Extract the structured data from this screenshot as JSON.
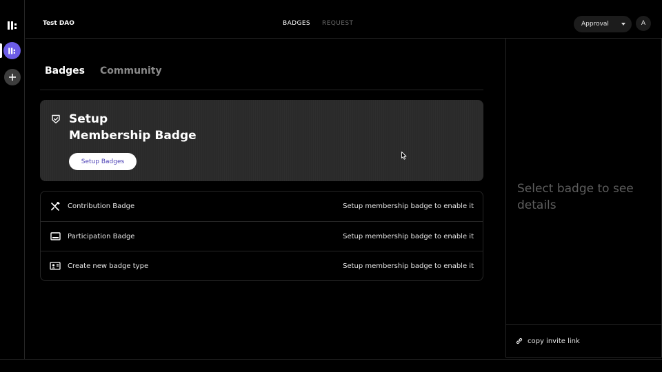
{
  "header": {
    "org_name": "Test DAO",
    "nav": [
      {
        "label": "BADGES",
        "active": true
      },
      {
        "label": "REQUEST",
        "active": false
      }
    ],
    "role_select": {
      "value": "Approval"
    },
    "avatar_initial": "A"
  },
  "rail": {
    "icons": [
      "app-logo-icon",
      "dao-logo-icon",
      "plus-icon"
    ]
  },
  "tabs": [
    {
      "label": "Badges",
      "active": true
    },
    {
      "label": "Community",
      "active": false
    }
  ],
  "setup_card": {
    "title_line1": "Setup",
    "title_line2": "Membership Badge",
    "button_label": "Setup Badges",
    "icon": "shield-check-icon"
  },
  "badges": [
    {
      "name": "Contribution Badge",
      "status": "Setup membership badge to enable it",
      "icon": "tools-icon"
    },
    {
      "name": "Participation Badge",
      "status": "Setup membership badge to enable it",
      "icon": "monitor-icon"
    },
    {
      "name": "Create new badge type",
      "status": "Setup membership badge to enable it",
      "icon": "id-card-icon"
    }
  ],
  "detail_panel": {
    "hint": "Select badge to see details",
    "invite_label": "copy invite link",
    "invite_icon": "link-icon"
  },
  "colors": {
    "accent": "#6c5ce7",
    "button_text": "#4a3fb5",
    "card_bg": "#2c2c2c",
    "muted": "#5e5e5e"
  }
}
